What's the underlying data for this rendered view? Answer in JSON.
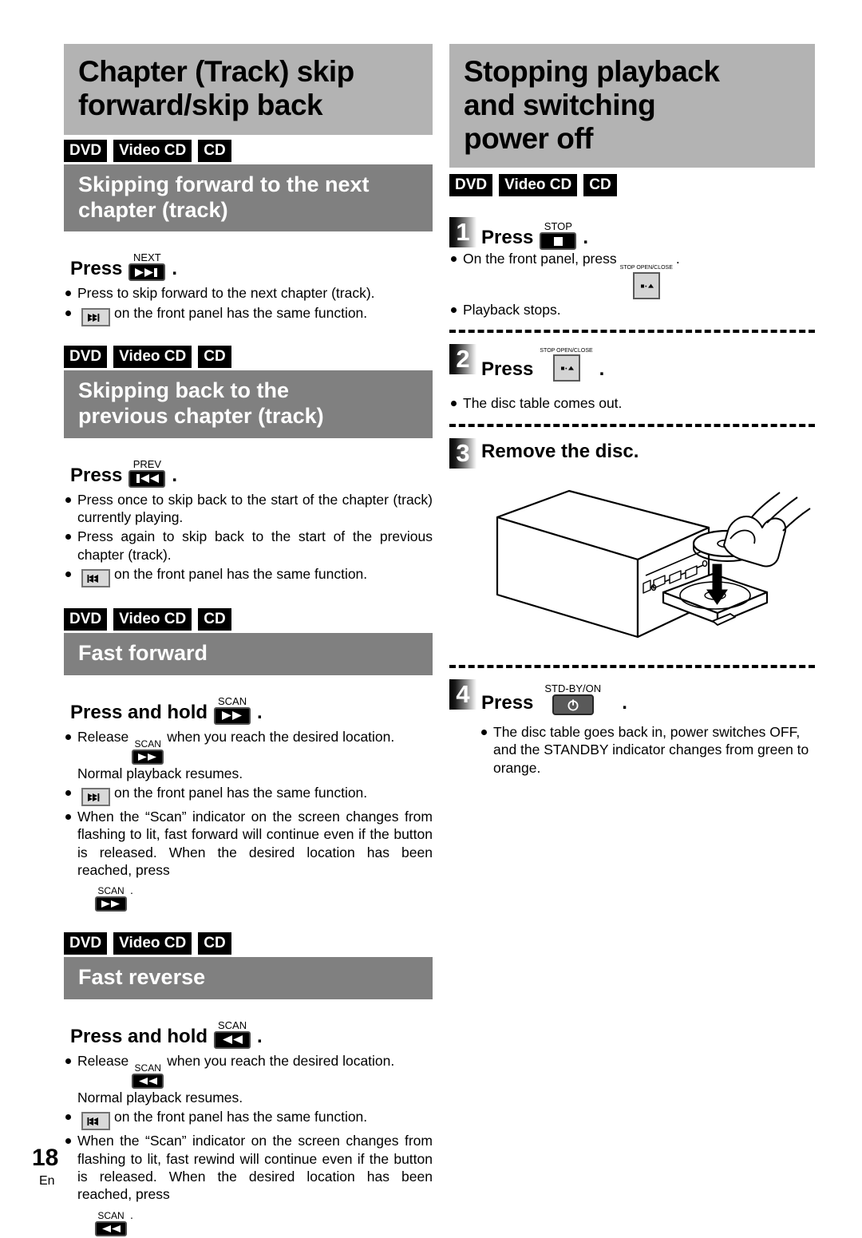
{
  "page": {
    "number": "18",
    "language": "En"
  },
  "left_column": {
    "chapter_title_lines": [
      "Chapter (Track) skip",
      "forward/skip back"
    ],
    "sections": [
      {
        "tags": [
          "DVD",
          "Video CD",
          "CD"
        ],
        "heading_lines": [
          "Skipping forward to the next",
          "chapter (track)"
        ],
        "instruction": {
          "verb": "Press",
          "key_label": "NEXT",
          "key_icon": "next-track-icon",
          "period": "."
        },
        "bullets": [
          {
            "text": "Press to skip forward to the next chapter (track)."
          },
          {
            "key_icon": "panel-next-icon",
            "text": "on the front panel has the same function."
          }
        ]
      },
      {
        "tags": [
          "DVD",
          "Video CD",
          "CD"
        ],
        "heading_lines": [
          "Skipping back to the",
          "previous chapter (track)"
        ],
        "instruction": {
          "verb": "Press",
          "key_label": "PREV",
          "key_icon": "prev-track-icon",
          "period": "."
        },
        "bullets": [
          {
            "text": "Press once to skip back to the start of the chapter (track) currently playing."
          },
          {
            "text": "Press again to skip back to the start of the previous chapter (track)."
          },
          {
            "key_icon": "panel-prev-icon",
            "text": "on the front panel has the same function."
          }
        ]
      },
      {
        "tags": [
          "DVD",
          "Video CD",
          "CD"
        ],
        "heading_lines": [
          "Fast forward"
        ],
        "instruction": {
          "verb": "Press and hold",
          "key_label": "SCAN",
          "key_icon": "scan-forward-icon",
          "period": "."
        },
        "bullets": [
          {
            "lead": "Release",
            "key_label": "SCAN",
            "key_icon": "scan-forward-icon",
            "text": "when you reach the desired location. Normal playback resumes."
          },
          {
            "key_icon": "panel-scan-forward-icon",
            "text": "on the front panel has the same function."
          },
          {
            "text": "When the “Scan” indicator on the screen changes from flashing to lit, fast forward will continue even if the button is released. When the desired location has been reached, press",
            "trailing_key_label": "SCAN",
            "trailing_key_icon": "scan-forward-icon",
            "trailing_period": "."
          }
        ]
      },
      {
        "tags": [
          "DVD",
          "Video CD",
          "CD"
        ],
        "heading_lines": [
          "Fast reverse"
        ],
        "instruction": {
          "verb": "Press and hold",
          "key_label": "SCAN",
          "key_icon": "scan-reverse-icon",
          "period": "."
        },
        "bullets": [
          {
            "lead": "Release",
            "key_label": "SCAN",
            "key_icon": "scan-reverse-icon",
            "text": "when you reach the desired location. Normal playback resumes."
          },
          {
            "key_icon": "panel-scan-reverse-icon",
            "text": "on the front panel has the same function."
          },
          {
            "text": "When the “Scan” indicator on the screen changes from flashing to lit, fast rewind will continue even if the button is released. When the desired location has been reached, press",
            "trailing_key_label": "SCAN",
            "trailing_key_icon": "scan-reverse-icon",
            "trailing_period": "."
          }
        ]
      }
    ]
  },
  "right_column": {
    "chapter_title_lines": [
      "Stopping playback",
      "and switching",
      "power off"
    ],
    "tags": [
      "DVD",
      "Video CD",
      "CD"
    ],
    "steps": [
      {
        "number": "1",
        "verb": "Press",
        "key_label": "STOP",
        "key_icon": "stop-icon",
        "period": ".",
        "bullets": [
          {
            "text": "On the front panel, press",
            "key_label": "STOP\nOPEN/CLOSE",
            "key_icon": "stop-open-close-icon",
            "trailing_period": "."
          },
          {
            "text": "Playback stops."
          }
        ]
      },
      {
        "number": "2",
        "verb": "Press",
        "key_label": "STOP\nOPEN/CLOSE",
        "key_icon": "stop-open-close-icon",
        "period": ".",
        "bullets": [
          {
            "text": "The disc table comes out."
          }
        ]
      },
      {
        "number": "3",
        "verb": "Remove the disc.",
        "bullets": []
      },
      {
        "number": "4",
        "verb": "Press",
        "key_label": "STD-BY/ON",
        "key_icon": "power-icon",
        "period": ".",
        "bullets": [
          {
            "text": "The disc table goes back in, power switches OFF, and the STANDBY indicator changes from green to orange."
          }
        ]
      }
    ],
    "illustration": {
      "name": "dvd-player-remove-disc-illustration",
      "caption": ""
    }
  },
  "colors": {
    "chapter_banner_bg": "#b3b3b3",
    "sub_banner_bg": "#808080",
    "tag_bg": "#000000",
    "tag_fg": "#ffffff",
    "panel_key_bg": "#d9d9d9",
    "power_key_bg": "#595959"
  }
}
